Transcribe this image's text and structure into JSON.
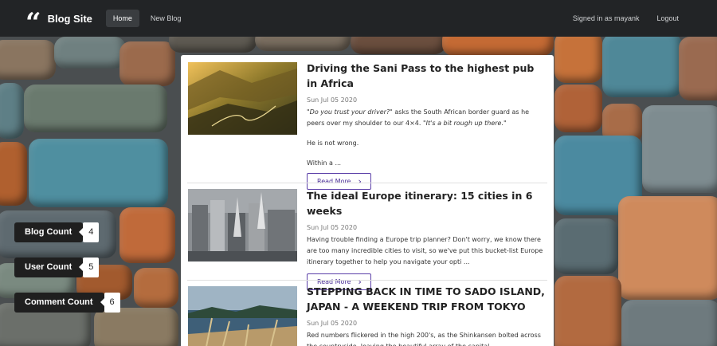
{
  "nav": {
    "brand": "Blog Site",
    "brand_icon": "quote-icon",
    "home": "Home",
    "new_blog": "New Blog",
    "signed_in": "Signed in as mayank",
    "logout": "Logout"
  },
  "counts": [
    {
      "label": "Blog Count",
      "value": "4"
    },
    {
      "label": "User Count",
      "value": "5"
    },
    {
      "label": "Comment Count",
      "value": "6"
    }
  ],
  "posts": [
    {
      "title": "Driving the Sani Pass to the highest pub in Africa",
      "date": "Sun Jul 05 2020",
      "excerpt_1a": "\"Do you trust your driver?\"",
      "excerpt_1b": " asks the South African border guard as he peers over my shoulder to our 4×4. ",
      "excerpt_1c": "\"It's a bit rough up there.\"",
      "excerpt_2": "He is not wrong.",
      "excerpt_3": "Within a ...",
      "read_more": "Read More"
    },
    {
      "title": "The ideal Europe itinerary: 15 cities in 6 weeks",
      "date": "Sun Jul 05 2020",
      "excerpt": "Having trouble finding a Europe trip planner? Don't worry, we know there are too many incredible cities to visit, so we've put this bucket-list Europe itinerary together to help you navigate your opti ...",
      "read_more": "Read More"
    },
    {
      "title": "STEPPING BACK IN TIME TO SADO ISLAND, JAPAN - A WEEKEND TRIP FROM TOKYO",
      "date": "Sun Jul 05 2020",
      "excerpt": "Red numbers flickered in the high 200's, as the Shinkansen bolted across the countryside, leaving the beautiful array of the capital"
    }
  ],
  "colors": {
    "navbar": "#222426",
    "accent": "#4a2f96",
    "badge_dark": "#1f1f1f"
  }
}
